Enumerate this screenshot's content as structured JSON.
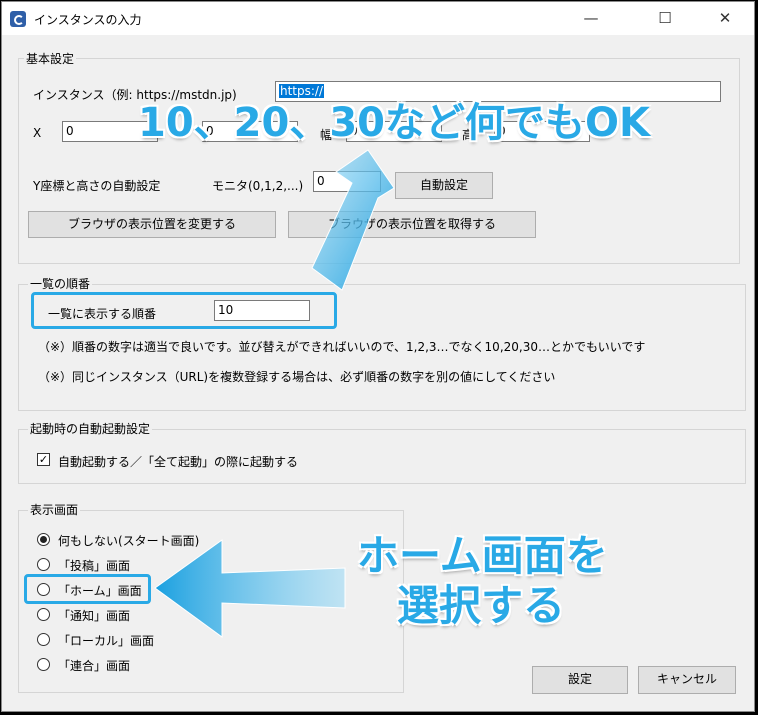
{
  "window": {
    "title": "インスタンスの入力",
    "min": "—",
    "max": "☐",
    "close": "✕"
  },
  "basic": {
    "group_title": "基本設定",
    "instance_label": "インスタンス（例: https://mstdn.jp)",
    "instance_value": "https://",
    "x_label": "X",
    "x_value": "0",
    "y_label": "Y",
    "y_value": "0",
    "width_label": "幅",
    "width_value": "0",
    "height_label": "高",
    "height_value": "0",
    "auto_label": "Y座標と高さの自動設定",
    "monitor_label": "モニタ(0,1,2,...)",
    "monitor_value": "0",
    "auto_button": "自動設定",
    "change_pos_button": "ブラウザの表示位置を変更する",
    "get_pos_button": "ブラウザの表示位置を取得する"
  },
  "order": {
    "group_title": "一覧の順番",
    "label": "一覧に表示する順番",
    "value": "10",
    "note1": "（※）順番の数字は適当で良いです。並び替えができればいいので、1,2,3…でなく10,20,30…とかでもいいです",
    "note2": "（※）同じインスタンス（URL)を複数登録する場合は、必ず順番の数字を別の値にしてください"
  },
  "autostart": {
    "group_title": "起動時の自動起動設定",
    "checkbox_label": "自動起動する／「全て起動」の際に起動する",
    "checked": true
  },
  "display": {
    "group_title": "表示画面",
    "options": [
      {
        "label": "何もしない(スタート画面)",
        "selected": true
      },
      {
        "label": "「投稿」画面",
        "selected": false
      },
      {
        "label": "「ホーム」画面",
        "selected": false
      },
      {
        "label": "「通知」画面",
        "selected": false
      },
      {
        "label": "「ローカル」画面",
        "selected": false
      },
      {
        "label": "「連合」画面",
        "selected": false
      }
    ]
  },
  "footer": {
    "ok_button": "設定",
    "cancel_button": "キャンセル"
  },
  "annotations": {
    "order_caption": "10、20、30など何でもOK",
    "home_caption_line1": "ホーム画面を",
    "home_caption_line2": "選択する",
    "accent_color": "#29a9e6"
  }
}
